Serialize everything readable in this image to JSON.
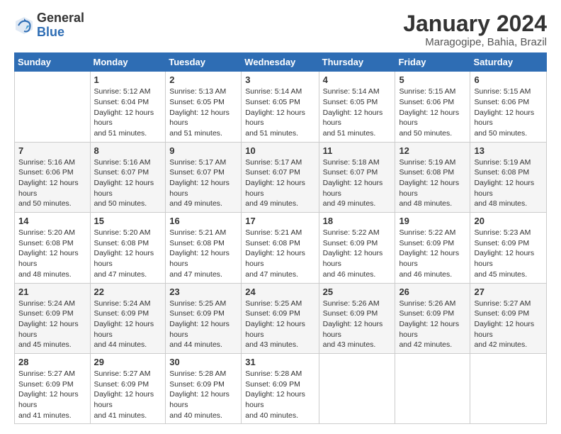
{
  "logo": {
    "general": "General",
    "blue": "Blue"
  },
  "title": "January 2024",
  "subtitle": "Maragogipe, Bahia, Brazil",
  "weekdays": [
    "Sunday",
    "Monday",
    "Tuesday",
    "Wednesday",
    "Thursday",
    "Friday",
    "Saturday"
  ],
  "weeks": [
    [
      {
        "day": "",
        "sunrise": "",
        "sunset": "",
        "daylight": ""
      },
      {
        "day": "1",
        "sunrise": "Sunrise: 5:12 AM",
        "sunset": "Sunset: 6:04 PM",
        "daylight": "Daylight: 12 hours and 51 minutes."
      },
      {
        "day": "2",
        "sunrise": "Sunrise: 5:13 AM",
        "sunset": "Sunset: 6:05 PM",
        "daylight": "Daylight: 12 hours and 51 minutes."
      },
      {
        "day": "3",
        "sunrise": "Sunrise: 5:14 AM",
        "sunset": "Sunset: 6:05 PM",
        "daylight": "Daylight: 12 hours and 51 minutes."
      },
      {
        "day": "4",
        "sunrise": "Sunrise: 5:14 AM",
        "sunset": "Sunset: 6:05 PM",
        "daylight": "Daylight: 12 hours and 51 minutes."
      },
      {
        "day": "5",
        "sunrise": "Sunrise: 5:15 AM",
        "sunset": "Sunset: 6:06 PM",
        "daylight": "Daylight: 12 hours and 50 minutes."
      },
      {
        "day": "6",
        "sunrise": "Sunrise: 5:15 AM",
        "sunset": "Sunset: 6:06 PM",
        "daylight": "Daylight: 12 hours and 50 minutes."
      }
    ],
    [
      {
        "day": "7",
        "sunrise": "Sunrise: 5:16 AM",
        "sunset": "Sunset: 6:06 PM",
        "daylight": "Daylight: 12 hours and 50 minutes."
      },
      {
        "day": "8",
        "sunrise": "Sunrise: 5:16 AM",
        "sunset": "Sunset: 6:07 PM",
        "daylight": "Daylight: 12 hours and 50 minutes."
      },
      {
        "day": "9",
        "sunrise": "Sunrise: 5:17 AM",
        "sunset": "Sunset: 6:07 PM",
        "daylight": "Daylight: 12 hours and 49 minutes."
      },
      {
        "day": "10",
        "sunrise": "Sunrise: 5:17 AM",
        "sunset": "Sunset: 6:07 PM",
        "daylight": "Daylight: 12 hours and 49 minutes."
      },
      {
        "day": "11",
        "sunrise": "Sunrise: 5:18 AM",
        "sunset": "Sunset: 6:07 PM",
        "daylight": "Daylight: 12 hours and 49 minutes."
      },
      {
        "day": "12",
        "sunrise": "Sunrise: 5:19 AM",
        "sunset": "Sunset: 6:08 PM",
        "daylight": "Daylight: 12 hours and 48 minutes."
      },
      {
        "day": "13",
        "sunrise": "Sunrise: 5:19 AM",
        "sunset": "Sunset: 6:08 PM",
        "daylight": "Daylight: 12 hours and 48 minutes."
      }
    ],
    [
      {
        "day": "14",
        "sunrise": "Sunrise: 5:20 AM",
        "sunset": "Sunset: 6:08 PM",
        "daylight": "Daylight: 12 hours and 48 minutes."
      },
      {
        "day": "15",
        "sunrise": "Sunrise: 5:20 AM",
        "sunset": "Sunset: 6:08 PM",
        "daylight": "Daylight: 12 hours and 47 minutes."
      },
      {
        "day": "16",
        "sunrise": "Sunrise: 5:21 AM",
        "sunset": "Sunset: 6:08 PM",
        "daylight": "Daylight: 12 hours and 47 minutes."
      },
      {
        "day": "17",
        "sunrise": "Sunrise: 5:21 AM",
        "sunset": "Sunset: 6:08 PM",
        "daylight": "Daylight: 12 hours and 47 minutes."
      },
      {
        "day": "18",
        "sunrise": "Sunrise: 5:22 AM",
        "sunset": "Sunset: 6:09 PM",
        "daylight": "Daylight: 12 hours and 46 minutes."
      },
      {
        "day": "19",
        "sunrise": "Sunrise: 5:22 AM",
        "sunset": "Sunset: 6:09 PM",
        "daylight": "Daylight: 12 hours and 46 minutes."
      },
      {
        "day": "20",
        "sunrise": "Sunrise: 5:23 AM",
        "sunset": "Sunset: 6:09 PM",
        "daylight": "Daylight: 12 hours and 45 minutes."
      }
    ],
    [
      {
        "day": "21",
        "sunrise": "Sunrise: 5:24 AM",
        "sunset": "Sunset: 6:09 PM",
        "daylight": "Daylight: 12 hours and 45 minutes."
      },
      {
        "day": "22",
        "sunrise": "Sunrise: 5:24 AM",
        "sunset": "Sunset: 6:09 PM",
        "daylight": "Daylight: 12 hours and 44 minutes."
      },
      {
        "day": "23",
        "sunrise": "Sunrise: 5:25 AM",
        "sunset": "Sunset: 6:09 PM",
        "daylight": "Daylight: 12 hours and 44 minutes."
      },
      {
        "day": "24",
        "sunrise": "Sunrise: 5:25 AM",
        "sunset": "Sunset: 6:09 PM",
        "daylight": "Daylight: 12 hours and 43 minutes."
      },
      {
        "day": "25",
        "sunrise": "Sunrise: 5:26 AM",
        "sunset": "Sunset: 6:09 PM",
        "daylight": "Daylight: 12 hours and 43 minutes."
      },
      {
        "day": "26",
        "sunrise": "Sunrise: 5:26 AM",
        "sunset": "Sunset: 6:09 PM",
        "daylight": "Daylight: 12 hours and 42 minutes."
      },
      {
        "day": "27",
        "sunrise": "Sunrise: 5:27 AM",
        "sunset": "Sunset: 6:09 PM",
        "daylight": "Daylight: 12 hours and 42 minutes."
      }
    ],
    [
      {
        "day": "28",
        "sunrise": "Sunrise: 5:27 AM",
        "sunset": "Sunset: 6:09 PM",
        "daylight": "Daylight: 12 hours and 41 minutes."
      },
      {
        "day": "29",
        "sunrise": "Sunrise: 5:27 AM",
        "sunset": "Sunset: 6:09 PM",
        "daylight": "Daylight: 12 hours and 41 minutes."
      },
      {
        "day": "30",
        "sunrise": "Sunrise: 5:28 AM",
        "sunset": "Sunset: 6:09 PM",
        "daylight": "Daylight: 12 hours and 40 minutes."
      },
      {
        "day": "31",
        "sunrise": "Sunrise: 5:28 AM",
        "sunset": "Sunset: 6:09 PM",
        "daylight": "Daylight: 12 hours and 40 minutes."
      },
      {
        "day": "",
        "sunrise": "",
        "sunset": "",
        "daylight": ""
      },
      {
        "day": "",
        "sunrise": "",
        "sunset": "",
        "daylight": ""
      },
      {
        "day": "",
        "sunrise": "",
        "sunset": "",
        "daylight": ""
      }
    ]
  ]
}
